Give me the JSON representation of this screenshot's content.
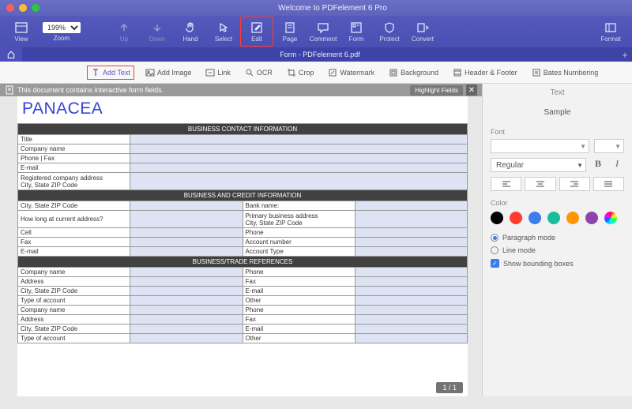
{
  "window": {
    "title": "Welcome to PDFelement 6 Pro"
  },
  "toolbar": {
    "view": "View",
    "zoom": "Zoom",
    "zoom_value": "199%",
    "up": "Up",
    "down": "Down",
    "hand": "Hand",
    "select": "Select",
    "edit": "Edit",
    "page": "Page",
    "comment": "Comment",
    "form": "Form",
    "protect": "Protect",
    "convert": "Convert",
    "format": "Format"
  },
  "tabs": {
    "filename": "Form - PDFelement 6.pdf"
  },
  "subtoolbar": {
    "add_text": "Add Text",
    "add_image": "Add Image",
    "link": "Link",
    "ocr": "OCR",
    "crop": "Crop",
    "watermark": "Watermark",
    "background": "Background",
    "header_footer": "Header & Footer",
    "bates": "Bates Numbering"
  },
  "infobar": {
    "msg": "This document contains interactive form fields.",
    "highlight": "Highlight Fields"
  },
  "doc": {
    "brand": "PANACEA",
    "sec1": "BUSINESS CONTACT INFORMATION",
    "sec2": "BUSINESS AND CREDIT INFORMATION",
    "sec3": "BUSINESS/TRADE REFERENCES",
    "rows": {
      "title": "Title",
      "company": "Company name",
      "phonefax": "Phone | Fax",
      "email": "E-mail",
      "regaddr1": "Registered company address",
      "regaddr2": "City, State ZIP Code",
      "csz": "City, State ZIP Code",
      "bank": "Bank name:",
      "howlong": "How long at current address?",
      "pba1": "Primary business address",
      "pba2": "City, State ZIP Code",
      "cell": "Cell",
      "phone": "Phone",
      "fax": "Fax",
      "acctnum": "Account number",
      "accttype": "Account Type",
      "address": "Address",
      "typeacct": "Type of account",
      "other": "Other"
    },
    "page_indicator": "1 / 1"
  },
  "panel": {
    "title": "Text",
    "sample": "Sample",
    "font": "Font",
    "regular": "Regular",
    "color": "Color",
    "colors": [
      "#000000",
      "#ff3b30",
      "#3b7ded",
      "#1abc9c",
      "#ff9500",
      "#8e44ad"
    ],
    "para": "Paragraph mode",
    "line": "Line mode",
    "boxes": "Show bounding boxes"
  }
}
